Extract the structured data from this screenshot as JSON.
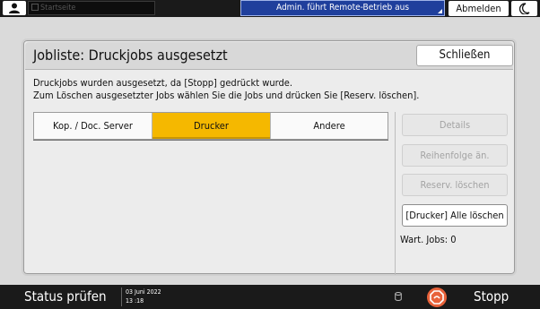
{
  "topbar": {
    "home_label": "Startseite",
    "remote_status": "Admin. führt Remote-Betrieb aus",
    "logout_label": "Abmelden"
  },
  "dialog": {
    "title": "Jobliste: Druckjobs ausgesetzt",
    "close_label": "Schließen",
    "message_line1": "Druckjobs wurden ausgesetzt, da [Stopp] gedrückt wurde.",
    "message_line2": "Zum Löschen ausgesetzter Jobs wählen Sie die Jobs und drücken Sie [Reserv. löschen].",
    "tabs": [
      {
        "label": "Kop. / Doc. Server",
        "selected": false
      },
      {
        "label": "Drucker",
        "selected": true
      },
      {
        "label": "Andere",
        "selected": false
      }
    ],
    "buttons": {
      "details": "Details",
      "reorder": "Reihenfolge än.",
      "delete_reserv": "Reserv. löschen",
      "delete_all": "[Drucker] Alle löschen"
    },
    "waiting_jobs_label": "Wart. Jobs:",
    "waiting_jobs_count": "0"
  },
  "statusbar": {
    "status_label": "Status prüfen",
    "date": "03 Juni 2022",
    "time": "13 :18",
    "stop_label": "Stopp"
  },
  "colors": {
    "selected_tab": "#f5b800",
    "remote_bar": "#1f3f9c",
    "stop_icon": "#e8623a"
  },
  "icons": [
    "user-icon",
    "home-mini-icon",
    "moon-icon",
    "database-icon",
    "stop-icon"
  ]
}
